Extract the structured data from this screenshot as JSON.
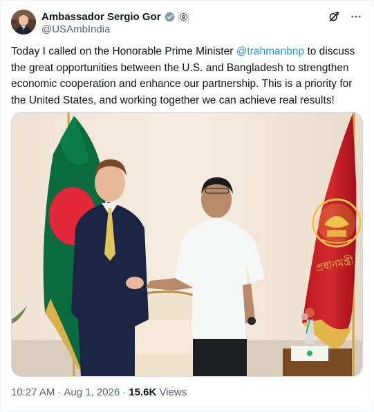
{
  "author": {
    "display_name": "Ambassador Sergio Gor",
    "handle": "@USAmbIndia"
  },
  "tweet": {
    "text_before": "Today I called on the Honorable Prime Minister ",
    "mention": "@trahmanbnp",
    "text_after": " to discuss the great opportunities between the U.S. and Bangladesh to strengthen economic cooperation and enhance our partnership. This is a priority for the United States, and working together we can achieve real results!"
  },
  "meta": {
    "time": "10:27 AM",
    "separator": "·",
    "date": "Aug 1, 2026",
    "views_count": "15.6K",
    "views_label": "Views"
  },
  "photo": {
    "flag_emblem_text": "প্রধানমন্ত্রী"
  },
  "icons": {
    "verified": "verified-badge-icon",
    "affiliate": "government-affiliate-icon",
    "grok": "grok-icon",
    "more": "more-icon"
  },
  "colors": {
    "accent": "#1d9bf0",
    "text_primary": "#0f1419",
    "text_secondary": "#536471",
    "bangladesh_green": "#006a4e",
    "bangladesh_red": "#f42a41",
    "pm_flag_red": "#c8102e"
  }
}
